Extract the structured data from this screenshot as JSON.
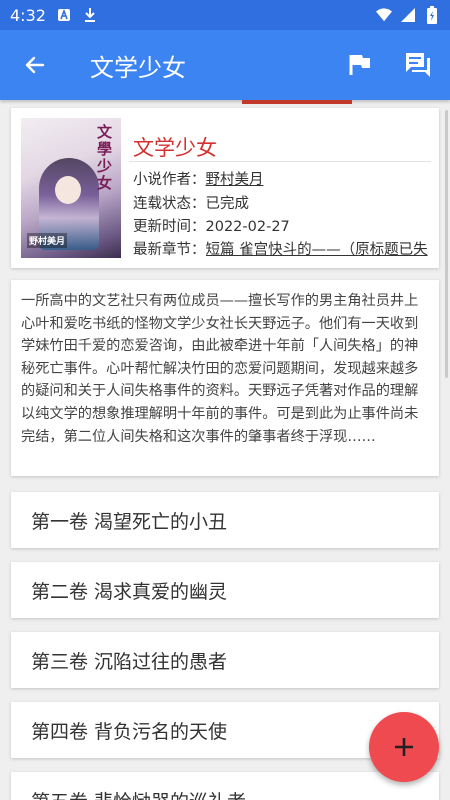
{
  "status_bar": {
    "time": "4:32"
  },
  "app_bar": {
    "title": "文学少女"
  },
  "book": {
    "cover_title": "文學少女",
    "cover_author": "野村美月",
    "title": "文学少女",
    "author_label": "小说作者：",
    "author": "野村美月",
    "status_label": "连载状态：",
    "status": "已完成",
    "updated_label": "更新时间：",
    "updated": "2022-02-27",
    "latest_label": "最新章节：",
    "latest": "短篇 雀宫快斗的——（原标题已失"
  },
  "description": "一所高中的文艺社只有两位成员——擅长写作的男主角社员井上心叶和爱吃书纸的怪物文学少女社长天野远子。他们有一天收到学妹竹田千爱的恋爱咨询，由此被牵进十年前「人间失格」的神秘死亡事件。心叶帮忙解决竹田的恋爱问题期间，发现越来越多的疑问和关于人间失格事件的资料。天野远子凭著对作品的理解以纯文学的想象推理解明十年前的事件。可是到此为止事件尚未完结，第二位人间失格和这次事件的肇事者终于浮现……",
  "volumes": [
    "第一卷 渴望死亡的小丑",
    "第二卷 渴求真爱的幽灵",
    "第三卷 沉陷过往的愚者",
    "第四卷 背负污名的天使",
    "第五卷 悲恰恸器的巡礼者"
  ],
  "colors": {
    "primary": "#3d84f3",
    "status_bar": "#2f6fe0",
    "accent": "#ee4a4f",
    "title_red": "#d32f2f"
  },
  "icons": [
    "back-arrow-icon",
    "flag-icon",
    "comments-icon",
    "plus-icon",
    "wifi-icon",
    "signal-icon",
    "battery-icon",
    "download-icon"
  ]
}
